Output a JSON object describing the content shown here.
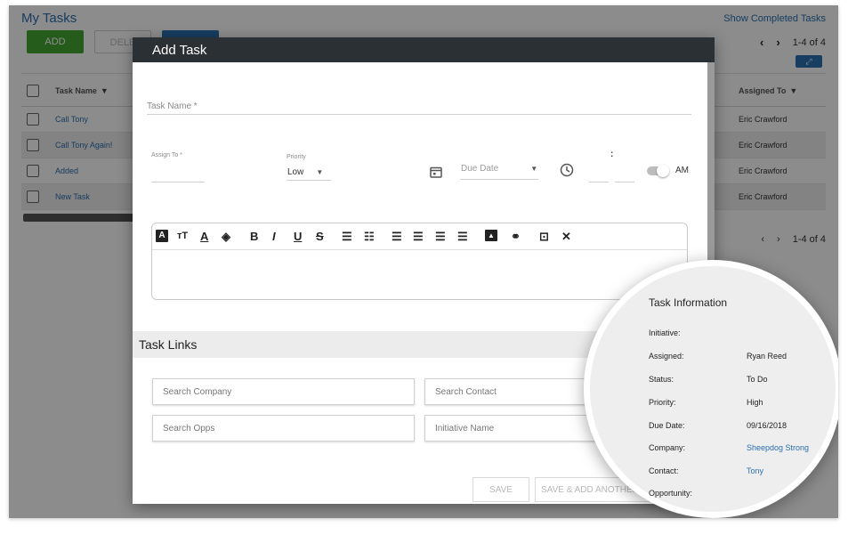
{
  "page": {
    "title": "My Tasks",
    "show_completed": "Show Completed Tasks",
    "add_label": "ADD",
    "delete_label": "DELE",
    "pager_text": "1-4 of 4",
    "pager_prev": "‹",
    "pager_next": "›",
    "expand_icon": "⤢"
  },
  "table": {
    "col_task": "Task Name",
    "col_assigned": "Assigned To",
    "filter_icon": "▼",
    "rows": [
      {
        "name": "Call Tony",
        "assigned": "Eric Crawford"
      },
      {
        "name": "Call Tony Again!",
        "assigned": "Eric Crawford"
      },
      {
        "name": "Added",
        "assigned": "Eric Crawford"
      },
      {
        "name": "New Task",
        "assigned": "Eric Crawford"
      }
    ]
  },
  "modal": {
    "title": "Add Task",
    "task_name_label": "Task Name *",
    "assign_to_label": "Assign To *",
    "priority_label": "Priority",
    "priority_value": "Low",
    "due_date_placeholder": "Due Date",
    "time_separator": ":",
    "am_label": "AM",
    "toolbar_icons": [
      "text-color-box-icon",
      "font-size-icon",
      "font-color-icon",
      "fill-color-icon",
      "bold-icon",
      "italic-icon",
      "underline-icon",
      "strikethrough-icon",
      "bullet-list-icon",
      "numbered-list-icon",
      "align-left-icon",
      "align-center-icon",
      "align-right-icon",
      "align-justify-icon",
      "image-icon",
      "link-icon",
      "select-all-icon",
      "clear-format-icon"
    ],
    "task_links_title": "Task Links",
    "search_company": "Search Company",
    "search_contact": "Search Contact",
    "search_opps": "Search Opps",
    "initiative_name": "Initiative Name",
    "save_label": "SAVE",
    "save_add_label": "SAVE & ADD ANOTHER"
  },
  "task_info": {
    "title": "Task Information",
    "rows": [
      {
        "label": "Initiative:",
        "value": ""
      },
      {
        "label": "Assigned:",
        "value": "Ryan Reed"
      },
      {
        "label": "Status:",
        "value": "To Do"
      },
      {
        "label": "Priority:",
        "value": "High"
      },
      {
        "label": "Due Date:",
        "value": "09/16/2018"
      },
      {
        "label": "Company:",
        "value": "Sheepdog Strong"
      },
      {
        "label": "Contact:",
        "value": "Tony"
      },
      {
        "label": "Opportunity:",
        "value": ""
      }
    ]
  },
  "colors": {
    "accent_blue": "#2a6fb0",
    "add_green": "#46a832",
    "modal_header": "#2b3034"
  }
}
